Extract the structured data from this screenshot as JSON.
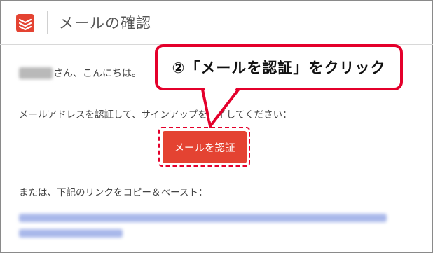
{
  "header": {
    "app_logo": "todoist-logo-icon",
    "title": "メールの確認"
  },
  "body": {
    "greeting_suffix": "さん、こんにちは。",
    "instruction": "メールアドレスを認証して、サインアップを完了してください：",
    "verify_button_label": "メールを認証",
    "alt_instruction": "または、下記のリンクをコピー＆ペースト："
  },
  "annotation": {
    "callout_text": "②「メールを認証」をクリック"
  },
  "colors": {
    "brand_red": "#e44332",
    "annotation_red": "#e4002b"
  }
}
